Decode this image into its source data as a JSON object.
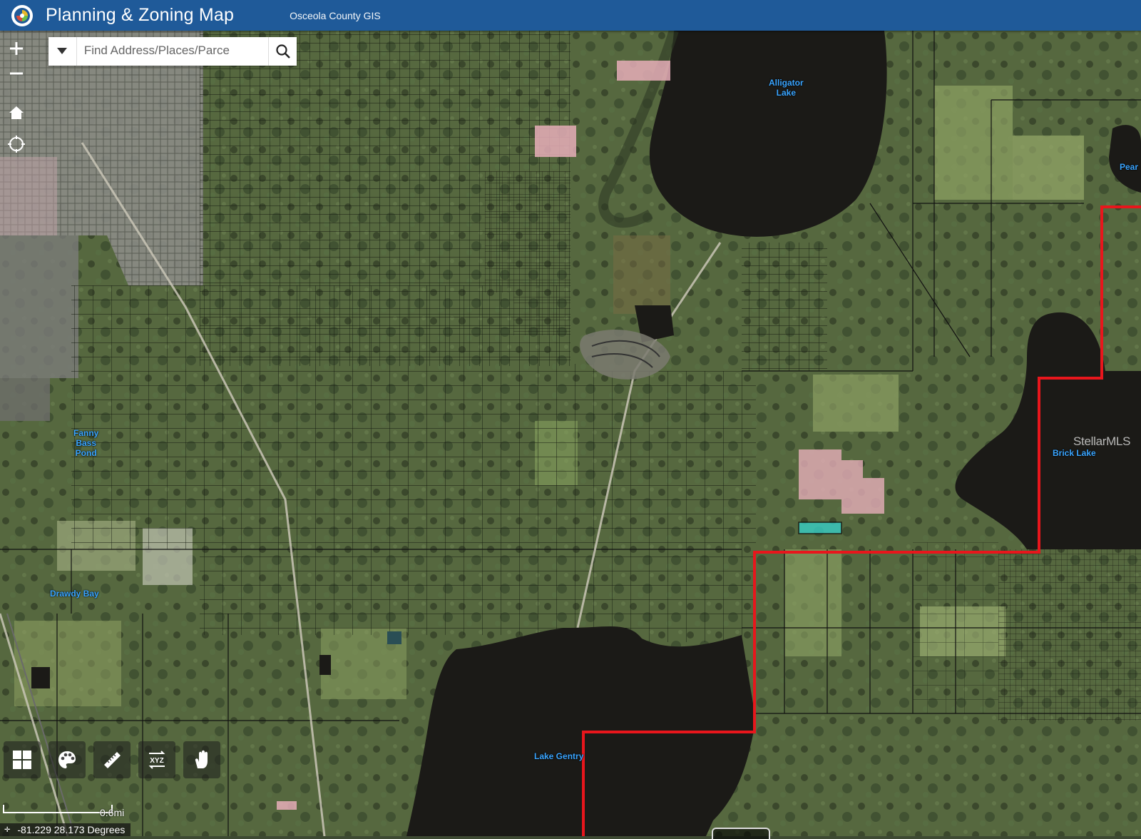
{
  "header": {
    "title": "Planning & Zoning Map",
    "subtitle": "Osceola County GIS"
  },
  "search": {
    "placeholder": "Find Address/Places/Parce"
  },
  "map": {
    "labels": {
      "alligator_lake": "Alligator\nLake",
      "pearl": "Pear",
      "brick_lake": "Brick Lake",
      "fanny_bass_pond": "Fanny\nBass\nPond",
      "drawdy_bay": "Drawdy Bay",
      "lake_gentry": "Lake Gentry"
    },
    "watermark": "StellarMLS",
    "colors": {
      "water": "#1b1a17",
      "boundary": "#e8161c",
      "selected_parcel": "#35d6d0",
      "zoning_pink": "#e6aeb9",
      "label_blue": "#3aa5ff"
    }
  },
  "toolbar": {
    "tools": [
      "basemap-gallery-icon",
      "layers-palette-icon",
      "measure-ruler-icon",
      "xyz-coordinates-icon",
      "draw-hand-icon"
    ],
    "xyz_text": "XYZ"
  },
  "scale": {
    "label": "0.6mi"
  },
  "coords": {
    "text": "-81.229 28.173 Degrees"
  }
}
